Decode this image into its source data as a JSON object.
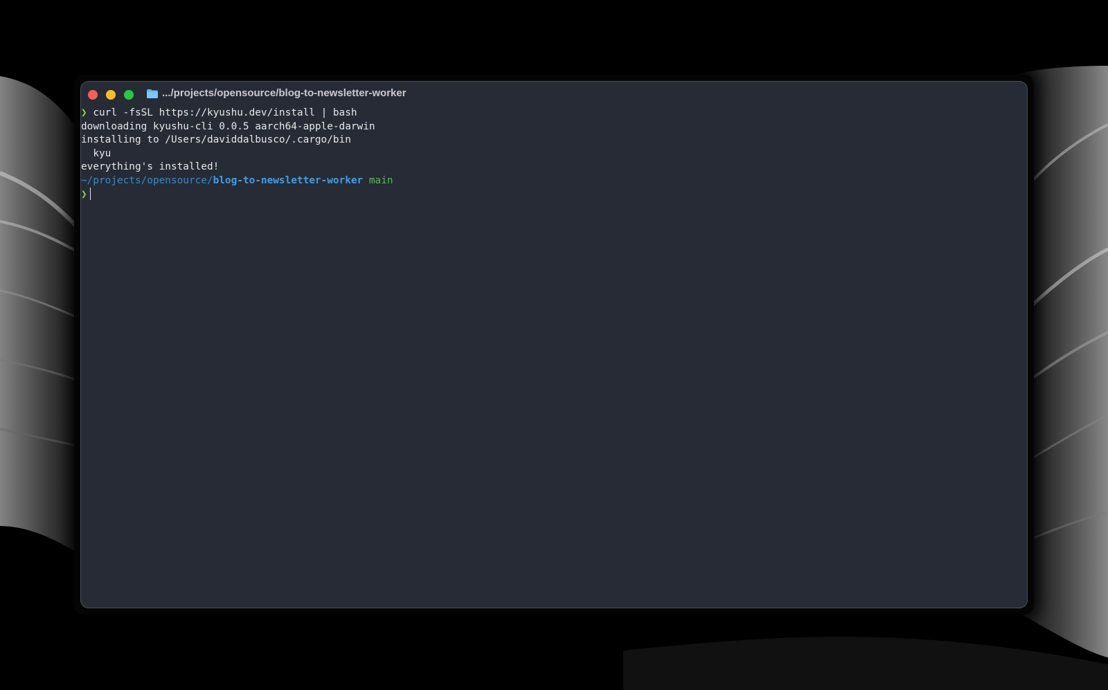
{
  "window": {
    "title": ".../projects/opensource/blog-to-newsletter-worker",
    "title_icon": "folder-icon"
  },
  "terminal": {
    "prompt_symbol": "❯",
    "command": " curl -fsSL https://kyushu.dev/install | bash",
    "output_lines": [
      "downloading kyushu-cli 0.0.5 aarch64-apple-darwin",
      "installing to /Users/daviddalbusco/.cargo/bin",
      "  kyu",
      "everything's installed!"
    ],
    "cwd_prefix": "~/projects/opensource/",
    "cwd_dir": "blog-to-newsletter-worker",
    "git_branch": " main"
  },
  "colors": {
    "terminal_bg": "#272b35",
    "prompt_green": "#8fd14f",
    "path_blue": "#3aa0f0",
    "branch_green": "#4cc24a",
    "close": "#ff5f57",
    "minimize": "#febc2e",
    "zoom": "#28c840"
  }
}
